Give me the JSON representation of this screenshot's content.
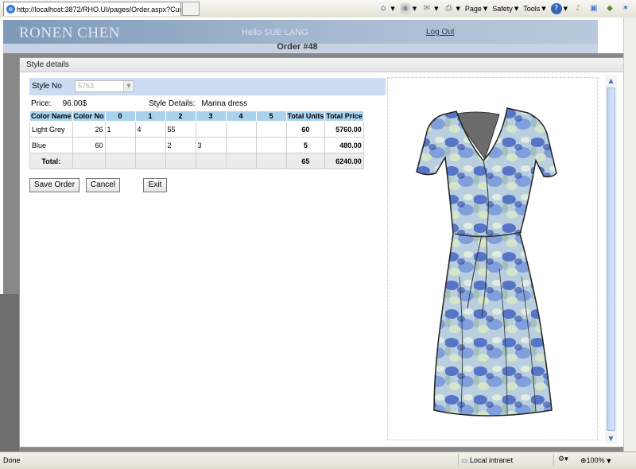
{
  "browser": {
    "tab_title": "http://localhost:3872/RHO.UI/pages/Order.aspx?Cus...",
    "toolbar": [
      "Page",
      "Safety",
      "Tools"
    ]
  },
  "site": {
    "brand": "RONEN CHEN",
    "greeting": "Hello SUE LANG",
    "logout": "Log Out",
    "order_title": "Order #48"
  },
  "dialog": {
    "title": "Style details",
    "style_no_label": "Style No",
    "style_no_value": "5753",
    "price_label": "Price:",
    "price_value": "96.00$",
    "details_label": "Style Details:",
    "details_value": "Marina dress",
    "table": {
      "headers": [
        "Color Name",
        "Color No",
        "0",
        "1",
        "2",
        "3",
        "4",
        "5",
        "Total Units",
        "Total Price"
      ],
      "rows": [
        {
          "color_name": "Light Grey",
          "color_no": "26",
          "s0": "1",
          "s1": "4",
          "s2": "55",
          "s3": "",
          "s4": "",
          "s5": "",
          "total_units": "60",
          "total_price": "5760.00"
        },
        {
          "color_name": "Blue",
          "color_no": "60",
          "s0": "",
          "s1": "",
          "s2": "2",
          "s3": "3",
          "s4": "",
          "s5": "",
          "total_units": "5",
          "total_price": "480.00"
        }
      ],
      "total": {
        "label": "Total:",
        "units": "65",
        "price": "6240.00"
      }
    },
    "buttons": {
      "save": "Save Order",
      "cancel": "Cancel",
      "exit": "Exit"
    }
  },
  "statusbar": {
    "status": "Done",
    "zone": "Local intranet",
    "zoom": "100%"
  }
}
